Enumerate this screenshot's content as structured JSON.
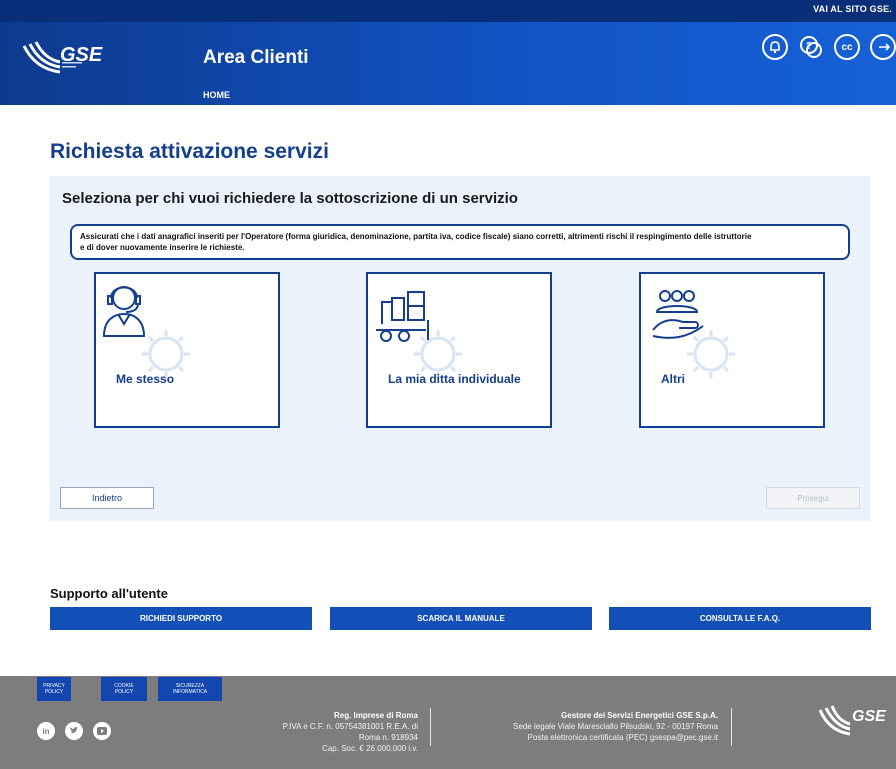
{
  "header": {
    "site_link": "VAI AL SITO GSE.",
    "logo": "GSE",
    "title": "Area Clienti",
    "breadcrumb": "HOME",
    "icons": [
      "bell-icon",
      "help-icon",
      "cc-icon",
      "logout-icon"
    ],
    "cc_label": "cc"
  },
  "main": {
    "title": "Richiesta attivazione servizi",
    "panel_title": "Seleziona per chi vuoi richiedere la sottoscrizione di un servizio",
    "notice_line1": "Assicurati che i dati anagrafici inseriti per l'Operatore (forma giuridica, denominazione, partita iva, codice fiscale) siano corretti, altrimenti rischi il respingimento delle istruttorie",
    "notice_line2": "e di dover nuovamente inserire le richieste.",
    "cards": [
      {
        "label": "Me stesso",
        "icon": "person-headset-icon"
      },
      {
        "label": "La mia ditta individuale",
        "icon": "warehouse-forklift-icon"
      },
      {
        "label": "Altri",
        "icon": "group-hand-icon"
      }
    ],
    "back_label": "Indietro",
    "next_label": "Prosegui"
  },
  "support": {
    "title": "Supporto all'utente",
    "buttons": [
      "RICHIEDI SUPPORTO",
      "SCARICA IL MANUALE",
      "CONSULTA LE F.A.Q."
    ]
  },
  "footer": {
    "links": [
      {
        "line1": "PRIVACY",
        "line2": "POLICY"
      },
      {
        "line1": "COOKIE",
        "line2": "POLICY"
      },
      {
        "line1": "SICUREZZA",
        "line2": "INFORMATICA"
      }
    ],
    "social": [
      "linkedin-icon",
      "twitter-icon",
      "youtube-icon"
    ],
    "registry": {
      "title": "Reg. Imprese di Roma",
      "line1": "P.IVA e C.F. n. 05754381001 R.E.A. di",
      "line2": "Roma n. 918934",
      "line3": "Cap. Soc. € 26.000.000 i.v."
    },
    "company": {
      "title": "Gestore dei Servizi Energetici GSE S.p.A.",
      "line1": "Sede legale Viale Maresciallo Pilsudski, 92 - 00197 Roma",
      "line2": "Posta elettronica certificata (PEC) gsespa@pec.gse.it"
    },
    "logo": "GSE"
  }
}
